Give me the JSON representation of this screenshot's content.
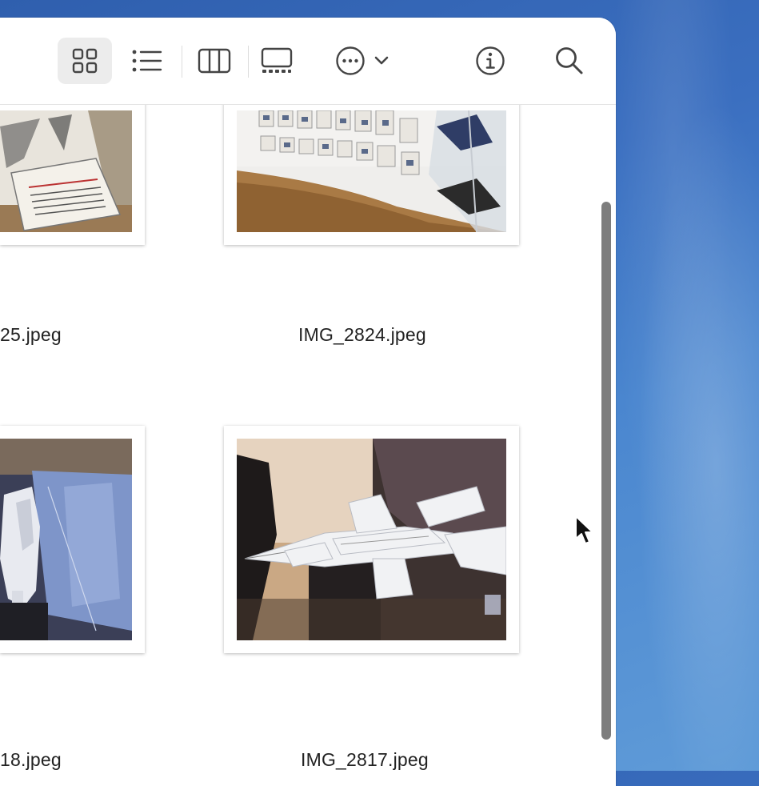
{
  "toolbar": {
    "view_icons": [
      "icon-view-grid-icon",
      "list-view-icon",
      "column-view-icon",
      "gallery-view-icon"
    ],
    "more_icon": "more-ellipsis-icon",
    "info_icon": "info-icon",
    "search_icon": "search-icon"
  },
  "files": [
    {
      "name": "25.jpeg"
    },
    {
      "name": "IMG_2824.jpeg"
    },
    {
      "name": "18.jpeg"
    },
    {
      "name": "IMG_2817.jpeg"
    }
  ],
  "colors": {
    "window_bg": "#ffffff",
    "desktop_blue": "#3b6fc0",
    "scrollbar": "#7d7d7d"
  }
}
